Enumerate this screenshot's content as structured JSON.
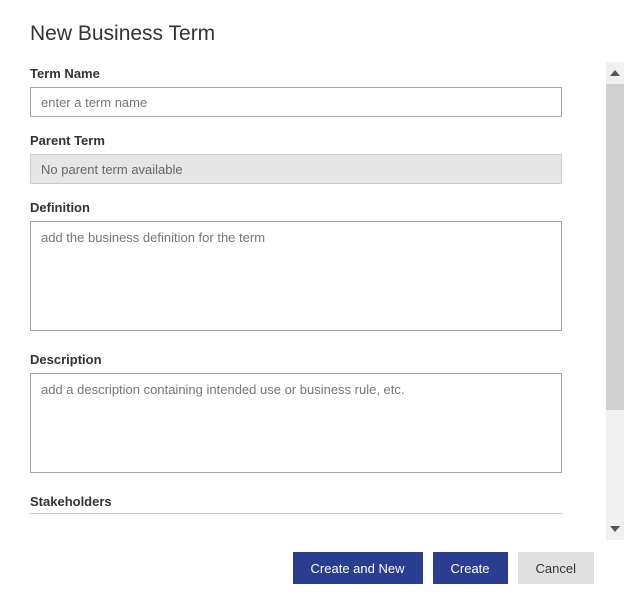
{
  "title": "New Business Term",
  "fields": {
    "termName": {
      "label": "Term Name",
      "placeholder": "enter a term name",
      "value": ""
    },
    "parentTerm": {
      "label": "Parent Term",
      "value": "No parent term available"
    },
    "definition": {
      "label": "Definition",
      "placeholder": "add the business definition for the term",
      "value": ""
    },
    "description": {
      "label": "Description",
      "placeholder": "add a description containing intended use or business rule, etc.",
      "value": ""
    },
    "stakeholders": {
      "label": "Stakeholders"
    }
  },
  "buttons": {
    "createAndNew": "Create and New",
    "create": "Create",
    "cancel": "Cancel"
  },
  "colors": {
    "primary": "#2b3d8f",
    "secondary": "#e0e0e0",
    "disabledBg": "#e6e6e6"
  }
}
